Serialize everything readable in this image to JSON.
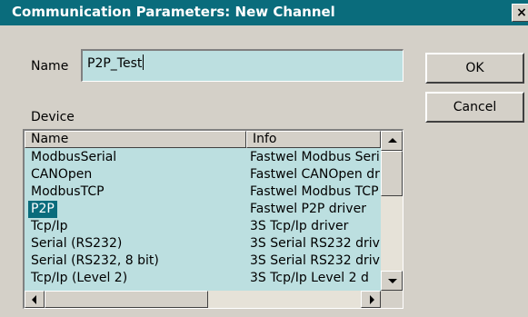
{
  "dialog": {
    "title": "Communication Parameters: New Channel",
    "close_glyph": "×"
  },
  "name_field": {
    "label": "Name",
    "value": "P2P_Test"
  },
  "buttons": {
    "ok": "OK",
    "cancel": "Cancel"
  },
  "device": {
    "label": "Device",
    "columns": {
      "name": "Name",
      "info": "Info"
    },
    "rows": [
      {
        "name": "ModbusSerial",
        "info": "Fastwel Modbus Seri"
      },
      {
        "name": "CANOpen",
        "info": "Fastwel CANOpen dr"
      },
      {
        "name": "ModbusTCP",
        "info": "Fastwel Modbus TCP"
      },
      {
        "name": "P2P",
        "info": "Fastwel P2P driver"
      },
      {
        "name": "Tcp/Ip",
        "info": "3S Tcp/Ip driver"
      },
      {
        "name": "Serial (RS232)",
        "info": "3S Serial RS232 driv"
      },
      {
        "name": "Serial (RS232, 8 bit)",
        "info": "3S Serial RS232 driv"
      },
      {
        "name": "Tcp/Ip (Level 2)",
        "info": "3S Tcp/Ip Level 2 d"
      }
    ],
    "selected_row": "P2P"
  },
  "icons": {
    "close": "close-icon",
    "scroll_up": "arrow-up-icon",
    "scroll_down": "arrow-down-icon",
    "scroll_left": "arrow-left-icon",
    "scroll_right": "arrow-right-icon"
  },
  "colors": {
    "titlebar": "#0a6c7c",
    "selection": "#0a6c7c",
    "field_background": "#bcdfe0",
    "face": "#d4d0c8"
  }
}
